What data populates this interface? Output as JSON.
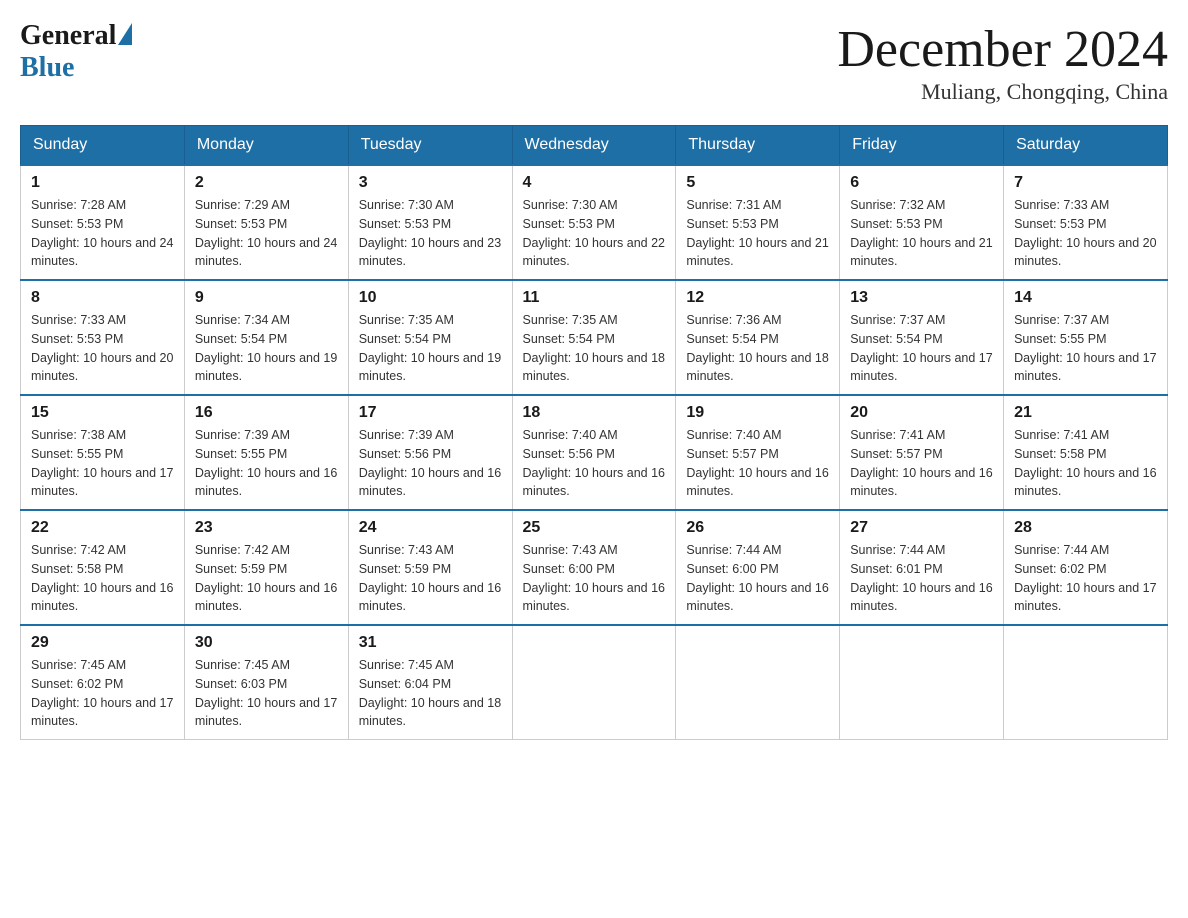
{
  "logo": {
    "general": "General",
    "blue": "Blue"
  },
  "title": "December 2024",
  "subtitle": "Muliang, Chongqing, China",
  "days": [
    "Sunday",
    "Monday",
    "Tuesday",
    "Wednesday",
    "Thursday",
    "Friday",
    "Saturday"
  ],
  "weeks": [
    [
      {
        "num": "1",
        "sunrise": "7:28 AM",
        "sunset": "5:53 PM",
        "daylight": "10 hours and 24 minutes."
      },
      {
        "num": "2",
        "sunrise": "7:29 AM",
        "sunset": "5:53 PM",
        "daylight": "10 hours and 24 minutes."
      },
      {
        "num": "3",
        "sunrise": "7:30 AM",
        "sunset": "5:53 PM",
        "daylight": "10 hours and 23 minutes."
      },
      {
        "num": "4",
        "sunrise": "7:30 AM",
        "sunset": "5:53 PM",
        "daylight": "10 hours and 22 minutes."
      },
      {
        "num": "5",
        "sunrise": "7:31 AM",
        "sunset": "5:53 PM",
        "daylight": "10 hours and 21 minutes."
      },
      {
        "num": "6",
        "sunrise": "7:32 AM",
        "sunset": "5:53 PM",
        "daylight": "10 hours and 21 minutes."
      },
      {
        "num": "7",
        "sunrise": "7:33 AM",
        "sunset": "5:53 PM",
        "daylight": "10 hours and 20 minutes."
      }
    ],
    [
      {
        "num": "8",
        "sunrise": "7:33 AM",
        "sunset": "5:53 PM",
        "daylight": "10 hours and 20 minutes."
      },
      {
        "num": "9",
        "sunrise": "7:34 AM",
        "sunset": "5:54 PM",
        "daylight": "10 hours and 19 minutes."
      },
      {
        "num": "10",
        "sunrise": "7:35 AM",
        "sunset": "5:54 PM",
        "daylight": "10 hours and 19 minutes."
      },
      {
        "num": "11",
        "sunrise": "7:35 AM",
        "sunset": "5:54 PM",
        "daylight": "10 hours and 18 minutes."
      },
      {
        "num": "12",
        "sunrise": "7:36 AM",
        "sunset": "5:54 PM",
        "daylight": "10 hours and 18 minutes."
      },
      {
        "num": "13",
        "sunrise": "7:37 AM",
        "sunset": "5:54 PM",
        "daylight": "10 hours and 17 minutes."
      },
      {
        "num": "14",
        "sunrise": "7:37 AM",
        "sunset": "5:55 PM",
        "daylight": "10 hours and 17 minutes."
      }
    ],
    [
      {
        "num": "15",
        "sunrise": "7:38 AM",
        "sunset": "5:55 PM",
        "daylight": "10 hours and 17 minutes."
      },
      {
        "num": "16",
        "sunrise": "7:39 AM",
        "sunset": "5:55 PM",
        "daylight": "10 hours and 16 minutes."
      },
      {
        "num": "17",
        "sunrise": "7:39 AM",
        "sunset": "5:56 PM",
        "daylight": "10 hours and 16 minutes."
      },
      {
        "num": "18",
        "sunrise": "7:40 AM",
        "sunset": "5:56 PM",
        "daylight": "10 hours and 16 minutes."
      },
      {
        "num": "19",
        "sunrise": "7:40 AM",
        "sunset": "5:57 PM",
        "daylight": "10 hours and 16 minutes."
      },
      {
        "num": "20",
        "sunrise": "7:41 AM",
        "sunset": "5:57 PM",
        "daylight": "10 hours and 16 minutes."
      },
      {
        "num": "21",
        "sunrise": "7:41 AM",
        "sunset": "5:58 PM",
        "daylight": "10 hours and 16 minutes."
      }
    ],
    [
      {
        "num": "22",
        "sunrise": "7:42 AM",
        "sunset": "5:58 PM",
        "daylight": "10 hours and 16 minutes."
      },
      {
        "num": "23",
        "sunrise": "7:42 AM",
        "sunset": "5:59 PM",
        "daylight": "10 hours and 16 minutes."
      },
      {
        "num": "24",
        "sunrise": "7:43 AM",
        "sunset": "5:59 PM",
        "daylight": "10 hours and 16 minutes."
      },
      {
        "num": "25",
        "sunrise": "7:43 AM",
        "sunset": "6:00 PM",
        "daylight": "10 hours and 16 minutes."
      },
      {
        "num": "26",
        "sunrise": "7:44 AM",
        "sunset": "6:00 PM",
        "daylight": "10 hours and 16 minutes."
      },
      {
        "num": "27",
        "sunrise": "7:44 AM",
        "sunset": "6:01 PM",
        "daylight": "10 hours and 16 minutes."
      },
      {
        "num": "28",
        "sunrise": "7:44 AM",
        "sunset": "6:02 PM",
        "daylight": "10 hours and 17 minutes."
      }
    ],
    [
      {
        "num": "29",
        "sunrise": "7:45 AM",
        "sunset": "6:02 PM",
        "daylight": "10 hours and 17 minutes."
      },
      {
        "num": "30",
        "sunrise": "7:45 AM",
        "sunset": "6:03 PM",
        "daylight": "10 hours and 17 minutes."
      },
      {
        "num": "31",
        "sunrise": "7:45 AM",
        "sunset": "6:04 PM",
        "daylight": "10 hours and 18 minutes."
      },
      null,
      null,
      null,
      null
    ]
  ]
}
